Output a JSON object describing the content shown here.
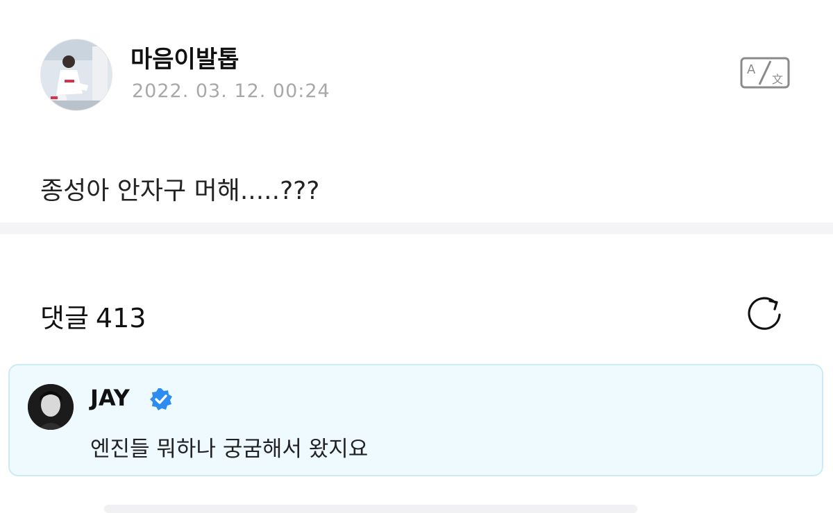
{
  "post": {
    "author": "마음이발톱",
    "timestamp": "2022. 03. 12. 00:24",
    "body": "종성아 안자구 머해.....???",
    "translate_icon": "translate-icon"
  },
  "comments": {
    "label": "댓글",
    "count": "413",
    "refresh_icon": "refresh-icon"
  },
  "pinned_comment": {
    "author": "JAY",
    "verified_icon": "verified-badge-icon",
    "text": "엔진들 뭐하나 궁굼해서 왔지요"
  },
  "colors": {
    "comment_bg": "#eefaff",
    "comment_border": "#cdebf3",
    "verified": "#2d8cf0",
    "timestamp": "#a8a8a8"
  }
}
